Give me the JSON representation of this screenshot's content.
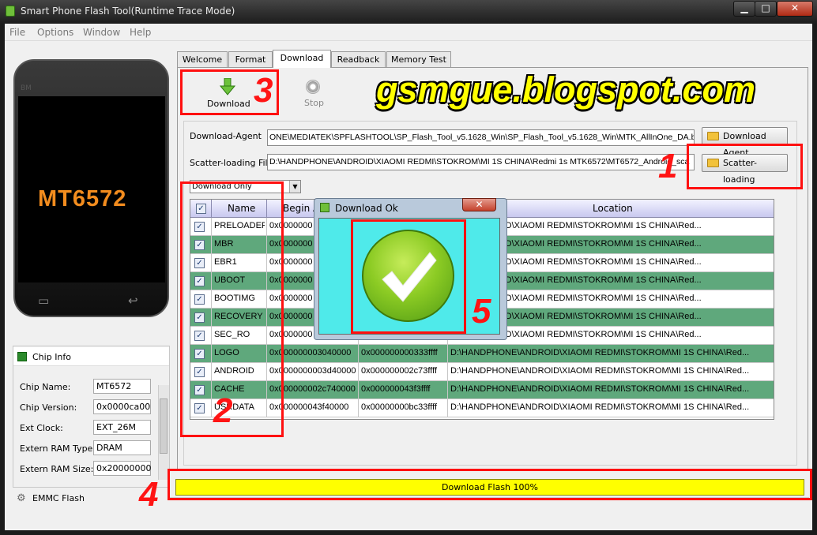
{
  "window": {
    "title": "Smart Phone Flash Tool(Runtime Trace Mode)",
    "controls": {
      "minimize": "▁",
      "maximize": "□",
      "close": "✕"
    }
  },
  "menu": [
    "File",
    "Options",
    "Window",
    "Help"
  ],
  "phone": {
    "brand": "BM",
    "chip": "MT6572",
    "back_key": "↩",
    "menu_key": "▭"
  },
  "chip_info": {
    "title": "Chip Info",
    "fields": [
      {
        "label": "Chip Name:",
        "value": "MT6572"
      },
      {
        "label": "Chip Version:",
        "value": "0x0000ca00"
      },
      {
        "label": "Ext Clock:",
        "value": "EXT_26M"
      },
      {
        "label": "Extern RAM Type:",
        "value": "DRAM"
      },
      {
        "label": "Extern RAM Size:",
        "value": "0x20000000"
      }
    ],
    "emmc_label": "EMMC Flash"
  },
  "tabs": [
    "Welcome",
    "Format",
    "Download",
    "Readback",
    "Memory Test"
  ],
  "active_tab": "Download",
  "toolbar": {
    "download_label": "Download",
    "stop_label": "Stop"
  },
  "watermark": "gsmgue.blogspot.com",
  "download_agent": {
    "label": "Download-Agent",
    "path": "ONE\\MEDIATEK\\SPFLASHTOOL\\SP_Flash_Tool_v5.1628_Win\\SP_Flash_Tool_v5.1628_Win\\MTK_AllInOne_DA.bin",
    "button": "Download Agent"
  },
  "scatter": {
    "label": "Scatter-loading File",
    "path": "D:\\HANDPHONE\\ANDROID\\XIAOMI REDMI\\STOKROM\\MI 1S CHINA\\Redmi 1s MTK6572\\MT6572_Android_sca",
    "button": "Scatter-loading"
  },
  "mode_select": "Download Only",
  "table": {
    "headers": [
      "Name",
      "Begin A",
      "",
      "Location"
    ],
    "rows": [
      {
        "name": "PRELOADER",
        "begin": "0x0000000",
        "end": "",
        "location": "ONE\\ANDROID\\XIAOMI REDMI\\STOKROM\\MI 1S CHINA\\Red..."
      },
      {
        "name": "MBR",
        "begin": "0x0000000",
        "end": "",
        "location": "ONE\\ANDROID\\XIAOMI REDMI\\STOKROM\\MI 1S CHINA\\Red..."
      },
      {
        "name": "EBR1",
        "begin": "0x0000000",
        "end": "",
        "location": "ONE\\ANDROID\\XIAOMI REDMI\\STOKROM\\MI 1S CHINA\\Red..."
      },
      {
        "name": "UBOOT",
        "begin": "0x0000000",
        "end": "",
        "location": "ONE\\ANDROID\\XIAOMI REDMI\\STOKROM\\MI 1S CHINA\\Red..."
      },
      {
        "name": "BOOTIMG",
        "begin": "0x0000000",
        "end": "",
        "location": "ONE\\ANDROID\\XIAOMI REDMI\\STOKROM\\MI 1S CHINA\\Red..."
      },
      {
        "name": "RECOVERY",
        "begin": "0x0000000",
        "end": "",
        "location": "ONE\\ANDROID\\XIAOMI REDMI\\STOKROM\\MI 1S CHINA\\Red..."
      },
      {
        "name": "SEC_RO",
        "begin": "0x0000000",
        "end": "",
        "location": "ONE\\ANDROID\\XIAOMI REDMI\\STOKROM\\MI 1S CHINA\\Red..."
      },
      {
        "name": "LOGO",
        "begin": "0x000000003040000",
        "end": "0x000000000333ffff",
        "location": "D:\\HANDPHONE\\ANDROID\\XIAOMI REDMI\\STOKROM\\MI 1S CHINA\\Red..."
      },
      {
        "name": "ANDROID",
        "begin": "0x0000000003d40000",
        "end": "0x000000002c73ffff",
        "location": "D:\\HANDPHONE\\ANDROID\\XIAOMI REDMI\\STOKROM\\MI 1S CHINA\\Red..."
      },
      {
        "name": "CACHE",
        "begin": "0x000000002c740000",
        "end": "0x000000043f3ffff",
        "location": "D:\\HANDPHONE\\ANDROID\\XIAOMI REDMI\\STOKROM\\MI 1S CHINA\\Red..."
      },
      {
        "name": "USRDATA",
        "begin": "0x000000043f40000",
        "end": "0x00000000bc33ffff",
        "location": "D:\\HANDPHONE\\ANDROID\\XIAOMI REDMI\\STOKROM\\MI 1S CHINA\\Red..."
      }
    ]
  },
  "progress": {
    "text": "Download Flash 100%",
    "value": 1.0,
    "color": "#ffff00"
  },
  "dialog": {
    "title": "Download Ok",
    "close": "✕"
  },
  "annotations": [
    "1",
    "2",
    "3",
    "4",
    "5"
  ],
  "colors": {
    "row_green": "#5fa87c",
    "dialog_bg": "#4feaea",
    "annotation_red": "#ff1010",
    "watermark": "#ffff00"
  }
}
